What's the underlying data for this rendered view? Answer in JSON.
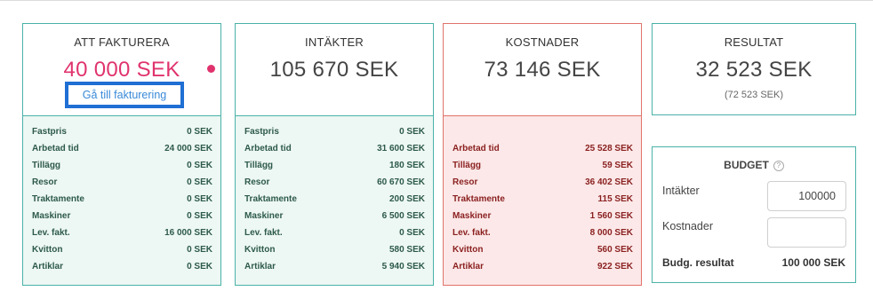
{
  "cards": {
    "fakturera": {
      "title": "ATT FAKTURERA",
      "value": "40 000 SEK",
      "button_label": "Gå till fakturering",
      "rows": [
        {
          "label": "Fastpris",
          "value": "0 SEK"
        },
        {
          "label": "Arbetad tid",
          "value": "24 000 SEK"
        },
        {
          "label": "Tillägg",
          "value": "0 SEK"
        },
        {
          "label": "Resor",
          "value": "0 SEK"
        },
        {
          "label": "Traktamente",
          "value": "0 SEK"
        },
        {
          "label": "Maskiner",
          "value": "0 SEK"
        },
        {
          "label": "Lev. fakt.",
          "value": "16 000 SEK"
        },
        {
          "label": "Kvitton",
          "value": "0 SEK"
        },
        {
          "label": "Artiklar",
          "value": "0 SEK"
        }
      ]
    },
    "intakter": {
      "title": "INTÄKTER",
      "value": "105 670 SEK",
      "rows": [
        {
          "label": "Fastpris",
          "value": "0 SEK"
        },
        {
          "label": "Arbetad tid",
          "value": "31 600 SEK"
        },
        {
          "label": "Tillägg",
          "value": "180 SEK"
        },
        {
          "label": "Resor",
          "value": "60 670 SEK"
        },
        {
          "label": "Traktamente",
          "value": "200 SEK"
        },
        {
          "label": "Maskiner",
          "value": "6 500 SEK"
        },
        {
          "label": "Lev. fakt.",
          "value": "0 SEK"
        },
        {
          "label": "Kvitton",
          "value": "580 SEK"
        },
        {
          "label": "Artiklar",
          "value": "5 940 SEK"
        }
      ]
    },
    "kostnader": {
      "title": "KOSTNADER",
      "value": "73 146 SEK",
      "rows": [
        {
          "label": "Arbetad tid",
          "value": "25 528 SEK"
        },
        {
          "label": "Tillägg",
          "value": "59 SEK"
        },
        {
          "label": "Resor",
          "value": "36 402 SEK"
        },
        {
          "label": "Traktamente",
          "value": "115 SEK"
        },
        {
          "label": "Maskiner",
          "value": "1 560 SEK"
        },
        {
          "label": "Lev. fakt.",
          "value": "8 000 SEK"
        },
        {
          "label": "Kvitton",
          "value": "560 SEK"
        },
        {
          "label": "Artiklar",
          "value": "922 SEK"
        }
      ]
    }
  },
  "resultat": {
    "title": "RESULTAT",
    "value": "32 523 SEK",
    "sub": "(72 523 SEK)"
  },
  "budget": {
    "title": "BUDGET",
    "help_icon": "?",
    "intakter_label": "Intäkter",
    "intakter_value": "100000",
    "kostnader_label": "Kostnader",
    "kostnader_value": "",
    "result_label": "Budg. resultat",
    "result_value": "100 000 SEK"
  },
  "colors": {
    "accent_teal": "#4ab2a8",
    "accent_red": "#e0736a",
    "pink_value": "#e0336e",
    "button_border": "#1f6fd4"
  }
}
